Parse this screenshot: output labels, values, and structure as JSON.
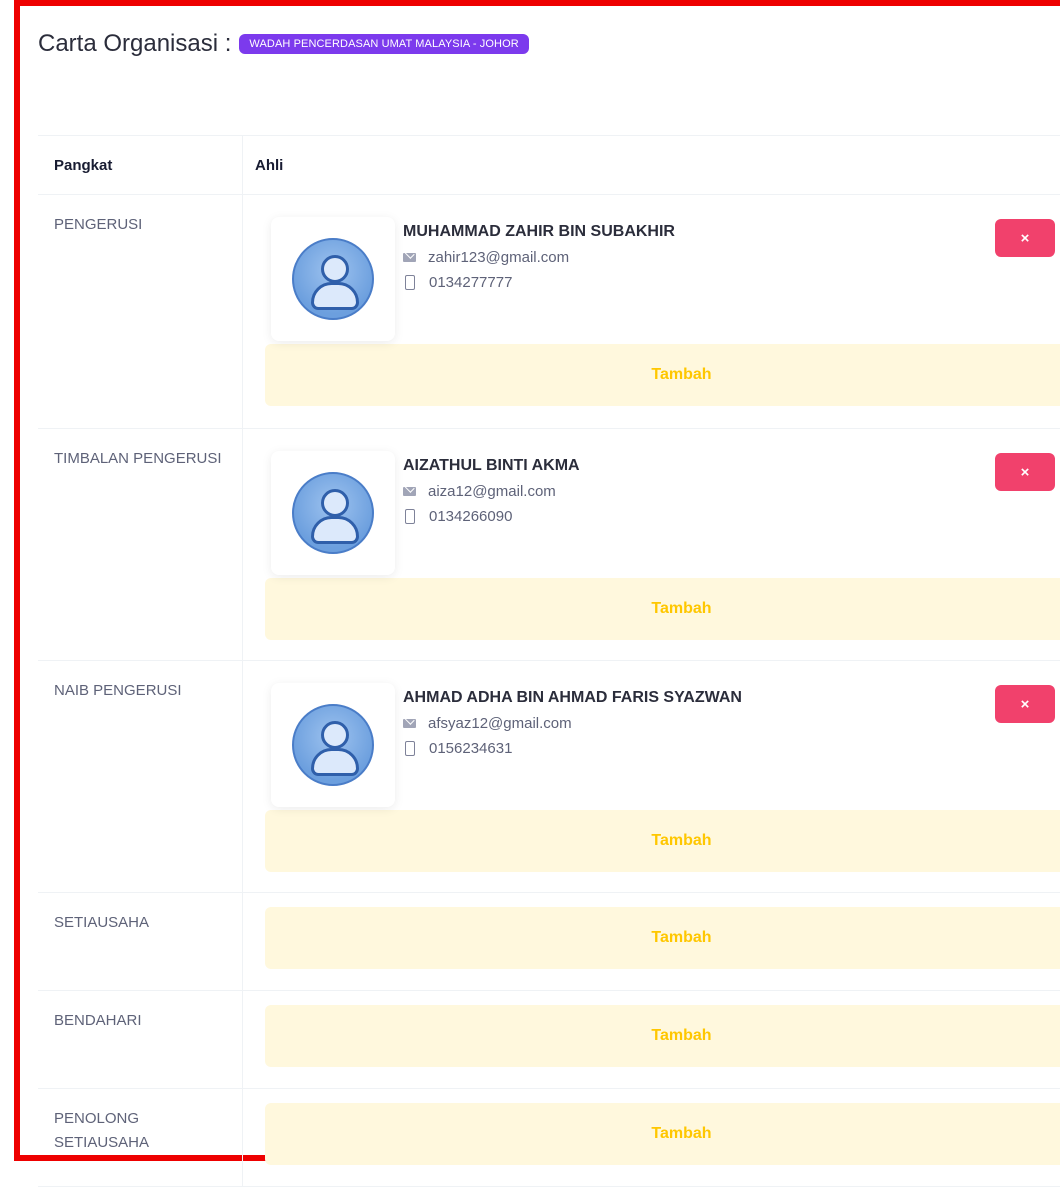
{
  "page": {
    "title": "Carta Organisasi :",
    "organization": "WADAH PENCERDASAN UMAT MALAYSIA - JOHOR"
  },
  "table": {
    "col_rank": "Pangkat",
    "col_member": "Ahli"
  },
  "rows": [
    {
      "rank": "PENGERUSI",
      "member": {
        "name": "MUHAMMAD ZAHIR BIN SUBAKHIR",
        "email": "zahir123@gmail.com",
        "phone": "0134277777"
      },
      "add_label": "Tambah",
      "remove_label": "×"
    },
    {
      "rank": "TIMBALAN PENGERUSI",
      "member": {
        "name": "AIZATHUL BINTI AKMA",
        "email": "aiza12@gmail.com",
        "phone": "0134266090"
      },
      "add_label": "Tambah",
      "remove_label": "×"
    },
    {
      "rank": "NAIB PENGERUSI",
      "member": {
        "name": "AHMAD ADHA BIN AHMAD FARIS SYAZWAN",
        "email": "afsyaz12@gmail.com",
        "phone": "0156234631"
      },
      "add_label": "Tambah",
      "remove_label": "×"
    },
    {
      "rank": "SETIAUSAHA",
      "add_label": "Tambah"
    },
    {
      "rank": "BENDAHARI",
      "add_label": "Tambah"
    },
    {
      "rank": "PENOLONG SETIAUSAHA",
      "add_label": "Tambah"
    }
  ],
  "colors": {
    "frame": "#ee0000",
    "badge": "#7c3aed",
    "remove": "#f1416c",
    "tambah_bg": "#fff8dd",
    "tambah_text": "#ffc700"
  },
  "icons": [
    "mail-icon",
    "phone-icon",
    "user-avatar-icon",
    "close-icon"
  ]
}
